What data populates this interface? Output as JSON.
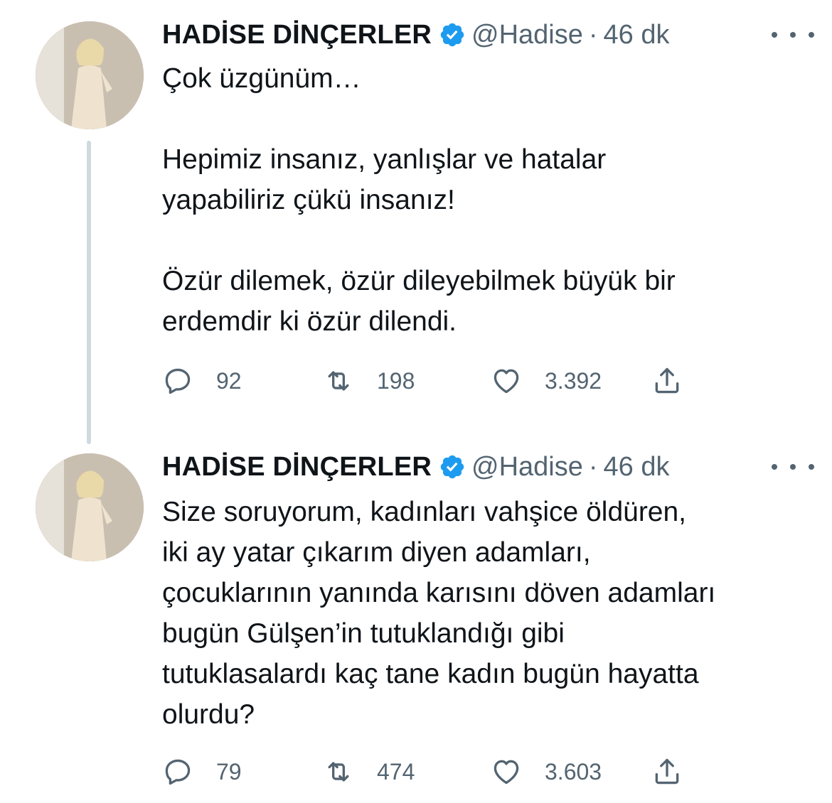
{
  "tweets": [
    {
      "author": {
        "name": "HADİSE DİNÇERLER",
        "handle": "@Hadise",
        "verified": true
      },
      "separator": "·",
      "time": "46 dk",
      "text": "Çok üzgünüm…\n\nHepimiz insanız, yanlışlar ve hatalar\nyapabiliriz çükü insanız!\n\nÖzür dilemek, özür dileyebilmek büyük bir\nerdemdir ki özür dilendi.",
      "stats": {
        "replies": "92",
        "retweets": "198",
        "likes": "3.392"
      }
    },
    {
      "author": {
        "name": "HADİSE DİNÇERLER",
        "handle": "@Hadise",
        "verified": true
      },
      "separator": "·",
      "time": "46 dk",
      "text": "Size soruyorum, kadınları vahşice öldüren,\niki ay yatar çıkarım diyen adamları,\nçocuklarının yanında karısını döven adamları\nbugün Gülşen’in tutuklandığı gibi\ntutuklasalardı kaç tane kadın bugün hayatta\nolurdu?",
      "stats": {
        "replies": "79",
        "retweets": "474",
        "likes": "3.603"
      }
    }
  ],
  "colors": {
    "verified": "#1d9bf0",
    "secondary_text": "#536471",
    "primary_text": "#0f1419",
    "thread_line": "#cfd9de"
  },
  "icons": [
    "verified-badge-icon",
    "more-icon",
    "reply-icon",
    "retweet-icon",
    "like-icon",
    "share-icon"
  ]
}
